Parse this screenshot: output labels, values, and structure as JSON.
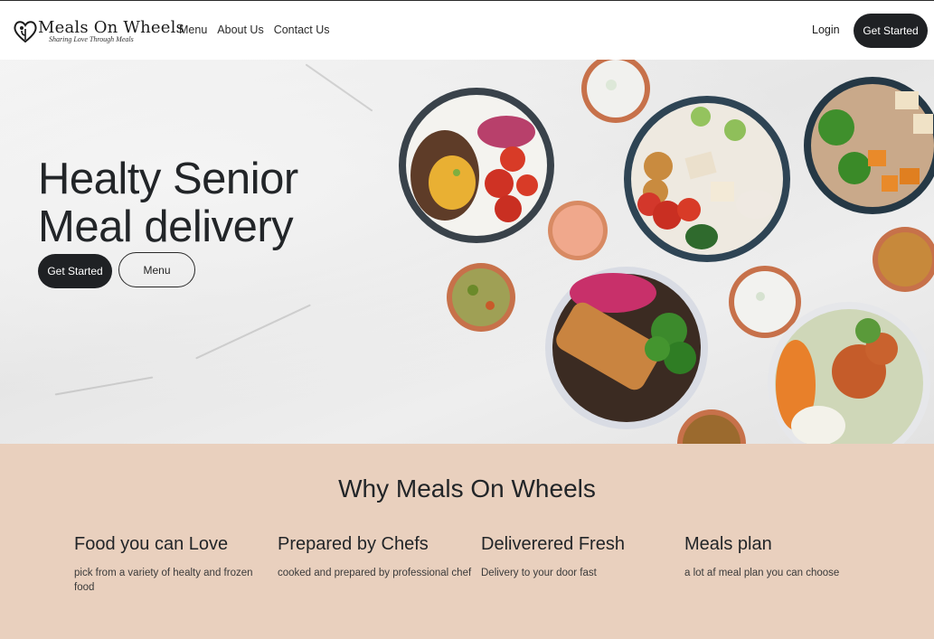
{
  "brand": {
    "name": "Meals On Wheels",
    "tagline": "Sharing Love Through Meals"
  },
  "nav": {
    "links": [
      "Menu",
      "About Us",
      "Contact Us"
    ],
    "login": "Login",
    "cta": "Get Started"
  },
  "hero": {
    "title_line1": "Healty Senior",
    "title_line2": "Meal delivery",
    "primary_button": "Get Started",
    "secondary_button": "Menu"
  },
  "why": {
    "title": "Why Meals On Wheels",
    "features": [
      {
        "title": "Food you can Love",
        "text": "pick from a variety of healty and frozen food"
      },
      {
        "title": "Prepared by Chefs",
        "text": "cooked and prepared by professional chef"
      },
      {
        "title": "Deliverered Fresh",
        "text": "Delivery to your door fast"
      },
      {
        "title": "Meals plan",
        "text": "a lot af meal plan you can choose"
      }
    ]
  },
  "colors": {
    "dark": "#1f2124",
    "section_bg": "#e9d0be"
  }
}
